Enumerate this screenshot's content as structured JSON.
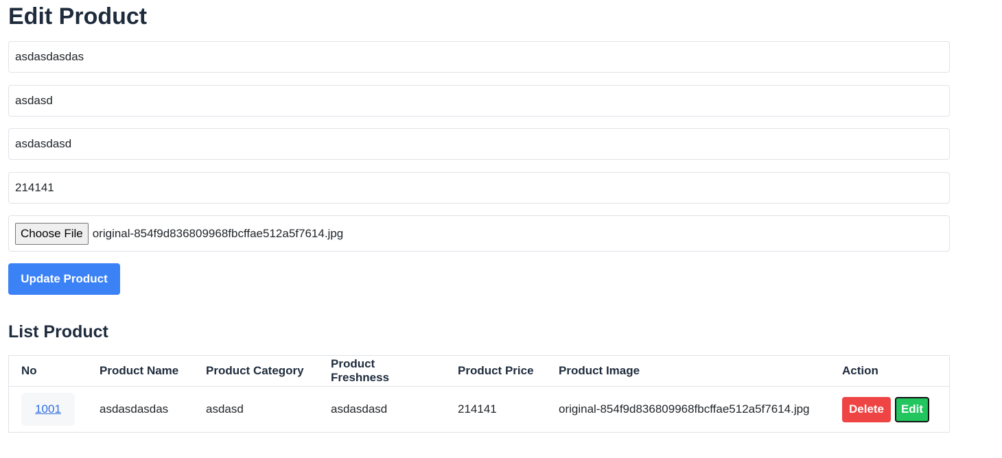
{
  "form": {
    "title": "Edit Product",
    "fields": {
      "name": "asdasdasdas",
      "category": "asdasd",
      "freshness": "asdasdasd",
      "price": "214141"
    },
    "file": {
      "button_label": "Choose File",
      "file_name": "original-854f9d836809968fbcffae512a5f7614.jpg"
    },
    "submit_label": "Update Product"
  },
  "list": {
    "title": "List Product",
    "columns": [
      "No",
      "Product Name",
      "Product Category",
      "Product Freshness",
      "Product Price",
      "Product Image",
      "Action"
    ],
    "rows": [
      {
        "no": "1001",
        "name": "asdasdasdas",
        "category": "asdasd",
        "freshness": "asdasdasd",
        "price": "214141",
        "image": "original-854f9d836809968fbcffae512a5f7614.jpg",
        "delete_label": "Delete",
        "edit_label": "Edit"
      }
    ]
  },
  "colors": {
    "primary": "#3b82f6",
    "danger": "#ef4444",
    "success": "#22c55e",
    "heading": "#1e2b3c"
  }
}
